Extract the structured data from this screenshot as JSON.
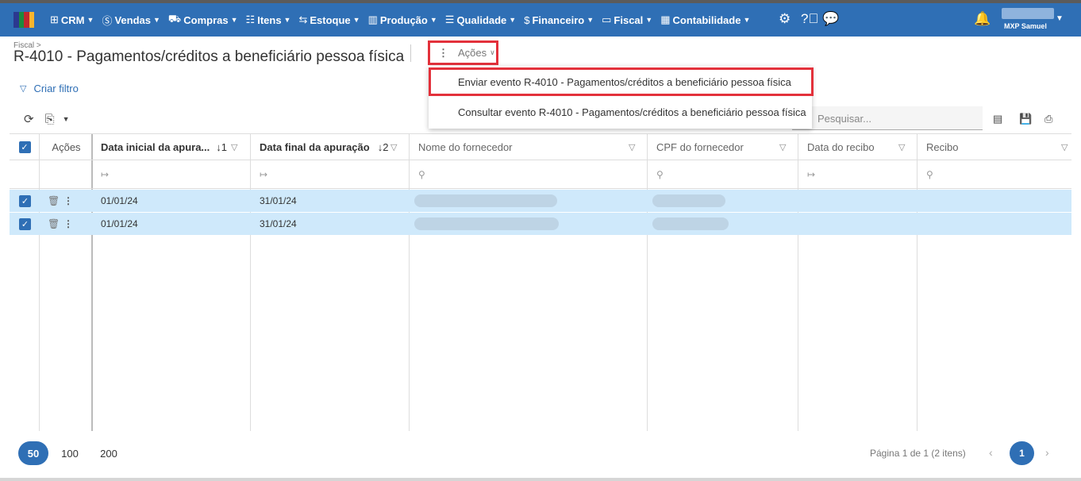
{
  "brand": {
    "colors": [
      "#2b3990",
      "#1c8a3e",
      "#c0272d",
      "#f7b52c"
    ]
  },
  "nav": [
    {
      "label": "CRM",
      "icon": "crm-icon"
    },
    {
      "label": "Vendas",
      "icon": "dollar-icon"
    },
    {
      "label": "Compras",
      "icon": "cart-icon"
    },
    {
      "label": "Itens",
      "icon": "list-icon"
    },
    {
      "label": "Estoque",
      "icon": "stock-icon"
    },
    {
      "label": "Produção",
      "icon": "factory-icon"
    },
    {
      "label": "Qualidade",
      "icon": "quality-icon"
    },
    {
      "label": "Financeiro",
      "icon": "money-bag-icon"
    },
    {
      "label": "Fiscal",
      "icon": "document-icon"
    },
    {
      "label": "Contabilidade",
      "icon": "calculator-icon"
    }
  ],
  "user": {
    "name": "MXP Samuel"
  },
  "page": {
    "breadcrumb": "Fiscal >",
    "title": "R-4010 - Pagamentos/créditos a beneficiário pessoa física",
    "actions_label": "Ações"
  },
  "actions_menu": [
    "Enviar evento R-4010 - Pagamentos/créditos a beneficiário pessoa física",
    "Consultar evento R-4010 - Pagamentos/créditos a beneficiário pessoa física"
  ],
  "filter": {
    "label": "Criar filtro"
  },
  "search": {
    "placeholder": "Pesquisar..."
  },
  "grid": {
    "actions_header": "Ações",
    "columns": [
      {
        "label": "Data inicial da apura...",
        "sort": "↓1"
      },
      {
        "label": "Data final da apuração",
        "sort": "↓2"
      },
      {
        "label": "Nome do fornecedor",
        "sort": ""
      },
      {
        "label": "CPF do fornecedor",
        "sort": ""
      },
      {
        "label": "Data do recibo",
        "sort": ""
      },
      {
        "label": "Recibo",
        "sort": ""
      }
    ],
    "rows": [
      {
        "data_inicial": "01/01/24",
        "data_final": "31/01/24",
        "checked": true
      },
      {
        "data_inicial": "01/01/24",
        "data_final": "31/01/24",
        "checked": true
      }
    ]
  },
  "pagination": {
    "sizes": [
      "50",
      "100",
      "200"
    ],
    "active_size": "50",
    "info": "Página 1 de 1 (2 itens)",
    "current_page": "1"
  }
}
